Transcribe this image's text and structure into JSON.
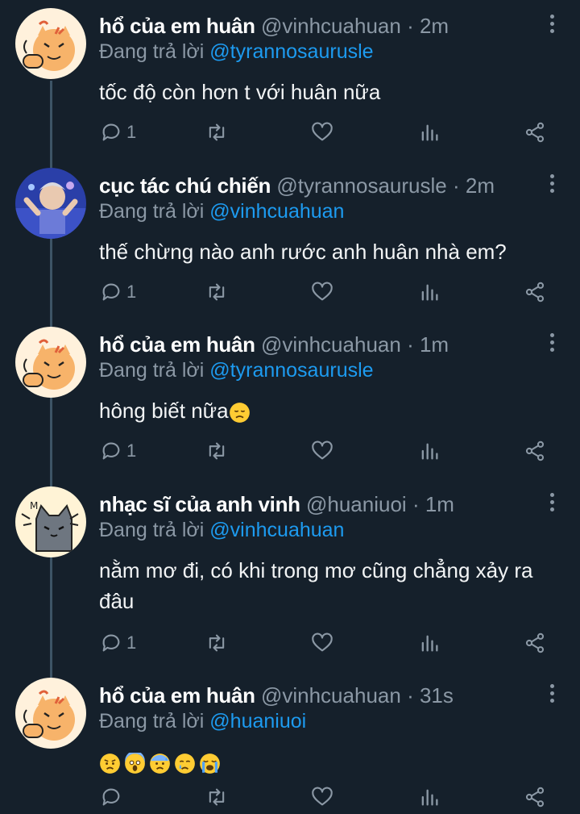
{
  "tweets": [
    {
      "name": "hổ của em huân",
      "handle": "@vinhcuahuan",
      "sep": "·",
      "time": "2m",
      "reply_prefix": "Đang trả lời",
      "reply_to": "@tyrannosaurusle",
      "text": "tốc độ còn hơn t với huân nữa",
      "reply_count": "1",
      "avatar": "tiger-avatar"
    },
    {
      "name": "cục tác chú chiến",
      "handle": "@tyrannosaurusle",
      "sep": "·",
      "time": "2m",
      "reply_prefix": "Đang trả lời",
      "reply_to": "@vinhcuahuan",
      "text": "thế chừng nào anh rước anh huân nhà em?",
      "reply_count": "1",
      "avatar": "photo-avatar"
    },
    {
      "name": "hổ của em huân",
      "handle": "@vinhcuahuan",
      "sep": "·",
      "time": "1m",
      "reply_prefix": "Đang trả lời",
      "reply_to": "@tyrannosaurusle",
      "text": "hông biết nữa",
      "reply_count": "1",
      "avatar": "tiger-avatar",
      "emoji": [
        "disappointed-face"
      ]
    },
    {
      "name": "nhạc sĩ của anh vinh",
      "handle": "@huaniuoi",
      "sep": "·",
      "time": "1m",
      "reply_prefix": "Đang trả lời",
      "reply_to": "@vinhcuahuan",
      "text": "nằm mơ đi, có khi trong mơ cũng chẳng xảy ra đâu",
      "reply_count": "1",
      "avatar": "cat-avatar"
    },
    {
      "name": "hổ của em huân",
      "handle": "@vinhcuahuan",
      "sep": "·",
      "time": "31s",
      "reply_prefix": "Đang trả lời",
      "reply_to": "@huaniuoi",
      "text": "",
      "reply_count": "",
      "avatar": "tiger-avatar",
      "emoji": [
        "worried-face",
        "screaming-face",
        "anxious-sweat-face",
        "crying-face",
        "loudly-crying-face"
      ]
    }
  ],
  "icons": {
    "reply": "reply-icon",
    "retweet": "retweet-icon",
    "like": "heart-icon",
    "stats": "analytics-icon",
    "share": "share-icon",
    "more": "more-icon"
  },
  "colors": {
    "background": "#15202b",
    "secondary_text": "#8b98a5",
    "mention": "#1d9bf0",
    "thread_line": "#3d5466"
  }
}
